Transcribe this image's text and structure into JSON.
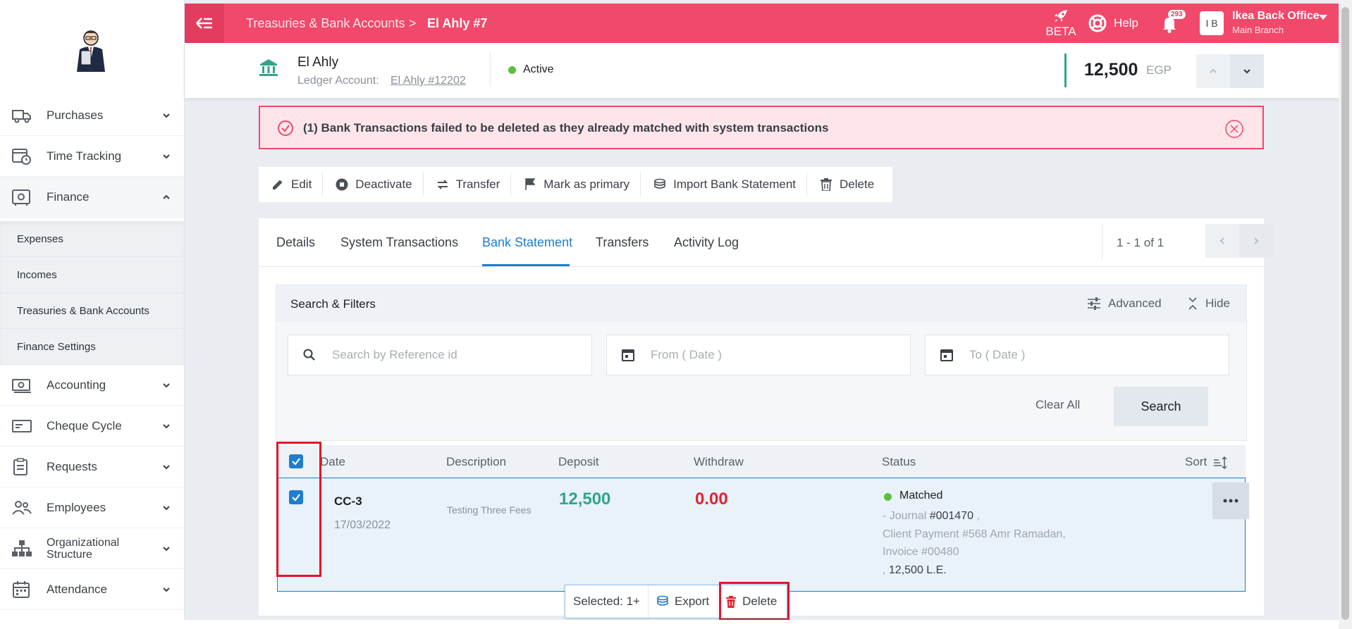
{
  "sidebar": {
    "items": [
      {
        "label": "Purchases",
        "icon": "truck-icon",
        "expanded": false
      },
      {
        "label": "Time Tracking",
        "icon": "calendar-clock-icon",
        "expanded": false
      },
      {
        "label": "Finance",
        "icon": "safe-icon",
        "expanded": true
      },
      {
        "label": "Accounting",
        "icon": "money-icon",
        "expanded": false
      },
      {
        "label": "Cheque Cycle",
        "icon": "cheque-icon",
        "expanded": false
      },
      {
        "label": "Requests",
        "icon": "clipboard-icon",
        "expanded": false
      },
      {
        "label": "Employees",
        "icon": "users-icon",
        "expanded": false
      },
      {
        "label": "Organizational Structure",
        "icon": "org-chart-icon",
        "expanded": false
      },
      {
        "label": "Attendance",
        "icon": "calendar-icon",
        "expanded": false
      }
    ],
    "finance_sub": [
      "Expenses",
      "Incomes",
      "Treasuries & Bank Accounts",
      "Finance Settings"
    ]
  },
  "topbar": {
    "breadcrumb_parent": "Treasuries & Bank Accounts",
    "breadcrumb_sep": ">",
    "breadcrumb_current": "El Ahly #7",
    "beta_label": "BETA",
    "help_label": "Help",
    "notifications_count": "293",
    "avatar_initials": "I B",
    "user_name": "Ikea Back Office",
    "user_branch": "Main Branch",
    "accent_color": "#f0496b"
  },
  "account": {
    "name": "El Ahly",
    "ledger_label": "Ledger Account:",
    "ledger_link": "El Ahly #12202",
    "status": "Active",
    "balance": "12,500",
    "currency": "EGP"
  },
  "alert": {
    "message": "(1) Bank Transactions failed to be deleted as they already matched with system transactions"
  },
  "actions": [
    "Edit",
    "Deactivate",
    "Transfer",
    "Mark as primary",
    "Import Bank Statement",
    "Delete"
  ],
  "tabs": {
    "items": [
      "Details",
      "System Transactions",
      "Bank Statement",
      "Transfers",
      "Activity Log"
    ],
    "active": "Bank Statement",
    "pager": "1 - 1 of 1"
  },
  "filters": {
    "title": "Search & Filters",
    "advanced_label": "Advanced",
    "hide_label": "Hide",
    "search_placeholder": "Search by Reference id",
    "from_placeholder": "From ( Date )",
    "to_placeholder": "To ( Date )",
    "clear_label": "Clear All",
    "search_label": "Search"
  },
  "table": {
    "columns": {
      "date": "Date",
      "description": "Description",
      "deposit": "Deposit",
      "withdraw": "Withdraw",
      "status": "Status",
      "sort": "Sort"
    },
    "rows": [
      {
        "ref": "CC-3",
        "date": "17/03/2022",
        "description": "Testing Three Fees",
        "deposit": "12,500",
        "withdraw": "0.00",
        "status": "Matched",
        "journal_prefix": "- Journal",
        "journal_no": "#001470",
        "journal_suffix": ",",
        "client_payment": "Client Payment #568 Amr Ramadan,",
        "invoice": "Invoice #00480",
        "amount_prefix": ",",
        "amount": "12,500 L.E."
      }
    ]
  },
  "selection_bar": {
    "selected": "Selected: 1+",
    "export_label": "Export",
    "delete_label": "Delete"
  }
}
